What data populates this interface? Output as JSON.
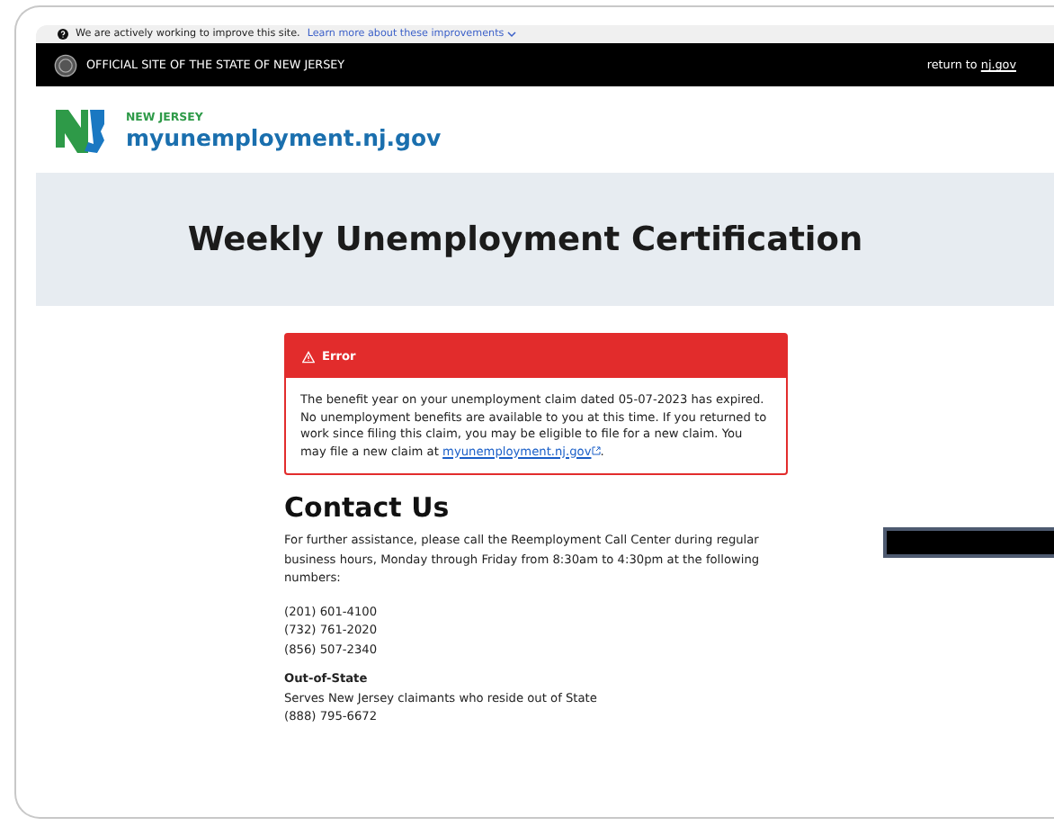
{
  "notice_bar": {
    "text": "We are actively working to improve this site.",
    "link": "Learn more about these improvements"
  },
  "official_bar": {
    "label": "OFFICIAL SITE OF THE STATE OF NEW JERSEY",
    "return_prefix": "return to",
    "return_link": "nj.gov"
  },
  "brand": {
    "state": "NEW JERSEY",
    "site": "myunemployment.nj.gov"
  },
  "page_title": "Weekly Unemployment Certification",
  "alert": {
    "title": "Error",
    "body_before": "The benefit year on your unemployment claim dated 05-07-2023 has expired. No unemployment benefits are available to you at this time. If you returned to work since filing this claim, you may be eligible to file for a new claim. You may file a new claim at",
    "link": "myunemployment.nj.gov",
    "body_after": "."
  },
  "contact": {
    "heading": "Contact Us",
    "intro": "For further assistance, please call the Reemployment Call Center during regular business hours, Monday through Friday from 8:30am to 4:30pm at the following numbers:",
    "phones": [
      "(201) 601-4100",
      "(732) 761-2020",
      "(856) 507-2340"
    ],
    "out_of_state": {
      "heading": "Out-of-State",
      "text": "Serves New Jersey claimants who reside out of State",
      "phone": "(888) 795-6672"
    }
  }
}
